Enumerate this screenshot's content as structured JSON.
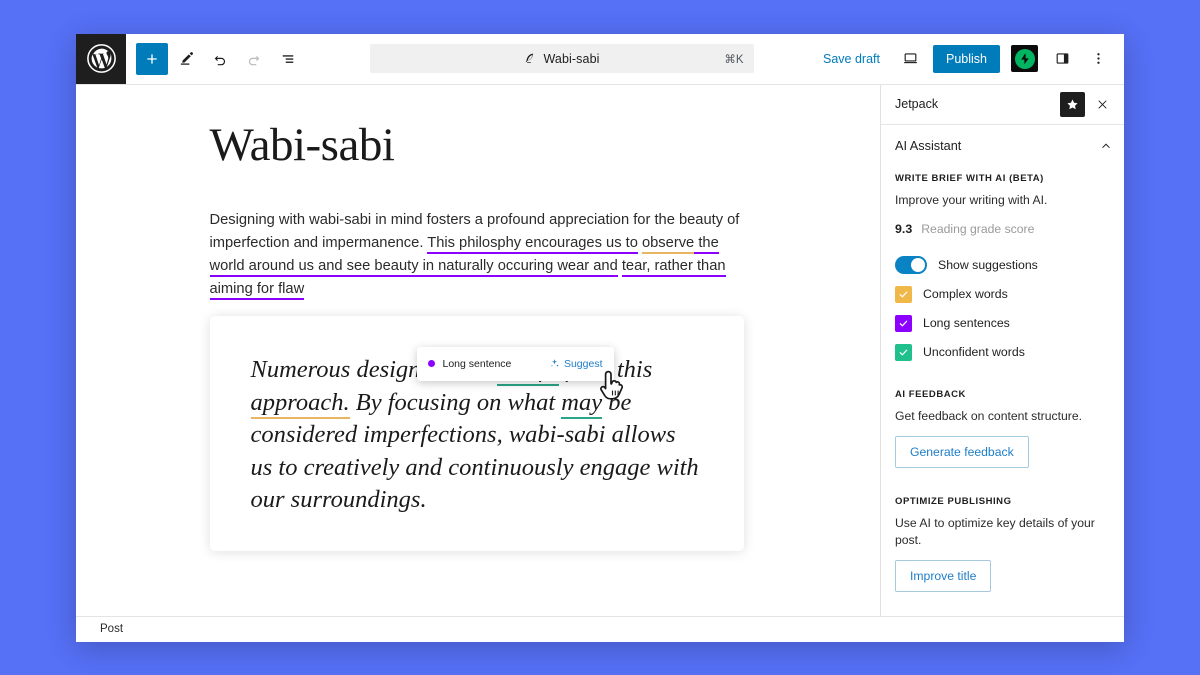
{
  "app": {
    "logo_icon": "wordpress-logo"
  },
  "toolbar": {
    "add_block_label": "+",
    "tools": [
      {
        "name": "add-block-button",
        "icon": "plus-icon"
      },
      {
        "name": "edit-tool-button",
        "icon": "pencil-icon"
      },
      {
        "name": "undo-button",
        "icon": "undo-arrow-icon"
      },
      {
        "name": "redo-button",
        "icon": "redo-arrow-icon"
      },
      {
        "name": "document-overview-button",
        "icon": "list-view-icon"
      }
    ],
    "document_chip": {
      "icon": "feather-quill-icon",
      "title": "Wabi-sabi",
      "shortcut": "⌘K"
    },
    "save_draft_label": "Save draft",
    "preview_icon": "device-preview-icon",
    "publish_label": "Publish",
    "jetpack_icon": "jetpack-lightning-icon",
    "settings_sidebar_icon": "sidebar-panel-icon",
    "options_icon": "three-dots-vertical-icon"
  },
  "editor": {
    "title": "Wabi-sabi",
    "paragraph": {
      "part1": "Designing with wabi-sabi in mind fosters a profound appreciation for the beauty of imperfection and impermanence. ",
      "highlight_purple_1": "This philosphy encourages us to",
      "highlight_orange": "observe",
      "mid": " the world around us and see beauty in naturally occuring wear and",
      "highlight_purple_2": "tear, rather than aiming for flaw"
    },
    "quote": {
      "line1_a": "Numerous designs could ",
      "line1_green": "benifit",
      "line1_b": " from this",
      "line2_orange": "approach.",
      "line2_b": " By focusing on what ",
      "line2_green": "may",
      "line2_c": " be",
      "line3": "considered imperfections, wabi-sabi allows us",
      "line4": "to creatively and continuously engage with our",
      "line5": "surroundings."
    },
    "suggestion_popover": {
      "dot_color": "#8c00ff",
      "label": "Long sentence",
      "action_label": "Suggest",
      "action_icon": "sparkles-icon"
    },
    "cursor_icon": "pointing-hand-cursor"
  },
  "sidebar": {
    "header": {
      "title": "Jetpack",
      "star_icon": "star-icon",
      "close_icon": "close-x-icon"
    },
    "panel": {
      "title": "AI Assistant",
      "collapse_icon": "chevron-up-icon"
    },
    "sections": [
      {
        "kicker": "WRITE BRIEF WITH AI (BETA)",
        "description": "Improve your writing with AI."
      },
      {
        "kicker": "AI FEEDBACK",
        "description": "Get feedback on content structure.",
        "button": "Generate feedback"
      },
      {
        "kicker": "OPTIMIZE PUBLISHING",
        "description": "Use AI to optimize key details of your post.",
        "button": "Improve title"
      }
    ],
    "reading_score": {
      "value": "9.3",
      "label": "Reading grade score"
    },
    "show_suggestions": {
      "label": "Show suggestions",
      "enabled": true
    },
    "checkboxes": [
      {
        "label": "Complex words",
        "color": "#f0b849",
        "checked": true
      },
      {
        "label": "Long sentences",
        "color": "#8c00ff",
        "checked": true
      },
      {
        "label": "Unconfident words",
        "color": "#1fc08b",
        "checked": true
      }
    ]
  },
  "statusbar": {
    "label": "Post"
  },
  "colors": {
    "desktop_background": "#5670f6",
    "accent_blue": "#007cba",
    "link_blue": "#1d7ec9",
    "jetpack_green": "#00b462"
  }
}
